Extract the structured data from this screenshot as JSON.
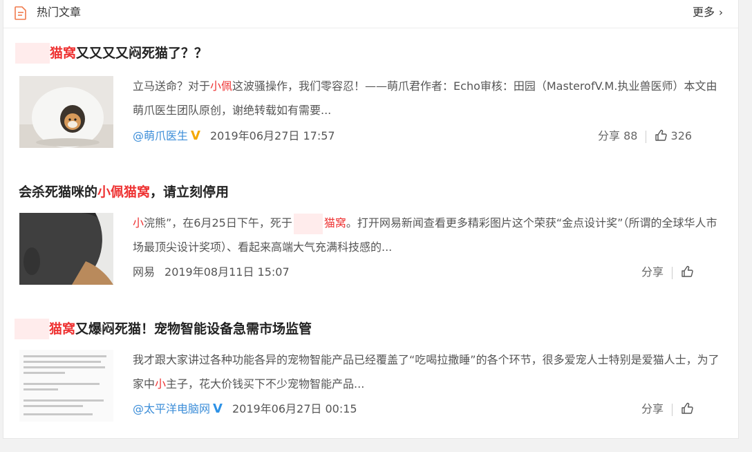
{
  "header": {
    "title": "热门文章",
    "more": "更多"
  },
  "articles": [
    {
      "title_red": "猫窝",
      "title_rest": "又又又又闷死猫了？？",
      "desc_a": "立马送命？对于",
      "desc_red": "小佩",
      "desc_b": "这波骚操作，我们零容忍！——萌爪君作者：Echo审核：田园（MasterofV.M.执业兽医师）本文由萌爪医生团队原创，谢绝转载如有需要...",
      "source": "@萌爪医生",
      "date": "2019年06月27日 17:57",
      "share": "分享 88",
      "likes": "326"
    },
    {
      "title_a": "会杀死猫咪的",
      "title_red": "小佩猫窝",
      "title_b": "，请立刻停用",
      "desc_red": "小",
      "desc_a": "浣熊”，在6月25日下午，死于",
      "desc_red2": "猫窝",
      "desc_b": "。打开网易新闻查看更多精彩图片这个荣获“金点设计奖”（所谓的全球华人市场最顶尖设计奖项）、看起来高端大气充满科技感的...",
      "source": "网易",
      "date": "2019年08月11日 15:07",
      "share": "分享"
    },
    {
      "title_red": "猫窝",
      "title_rest": "又爆闷死猫！宠物智能设备急需市场监管",
      "desc_a": "我才跟大家讲过各种功能各异的宠物智能产品已经覆盖了“吃喝拉撒睡”的各个环节，很多爱宠人士特别是爱猫人士，为了家中",
      "desc_red": "小",
      "desc_b": "主子，花大价钱买下不少宠物智能产品...",
      "source": "@太平洋电脑网",
      "date": "2019年06月27日 00:15",
      "share": "分享"
    }
  ],
  "colors": {
    "accent_red": "#ee3333",
    "link_blue": "#3b8dd8",
    "badge_gold": "#f4a800",
    "badge_blue": "#2e92e6"
  },
  "icons": [
    "document-icon",
    "chevron-right-icon",
    "thumbs-up-icon",
    "verified-v-icon"
  ]
}
